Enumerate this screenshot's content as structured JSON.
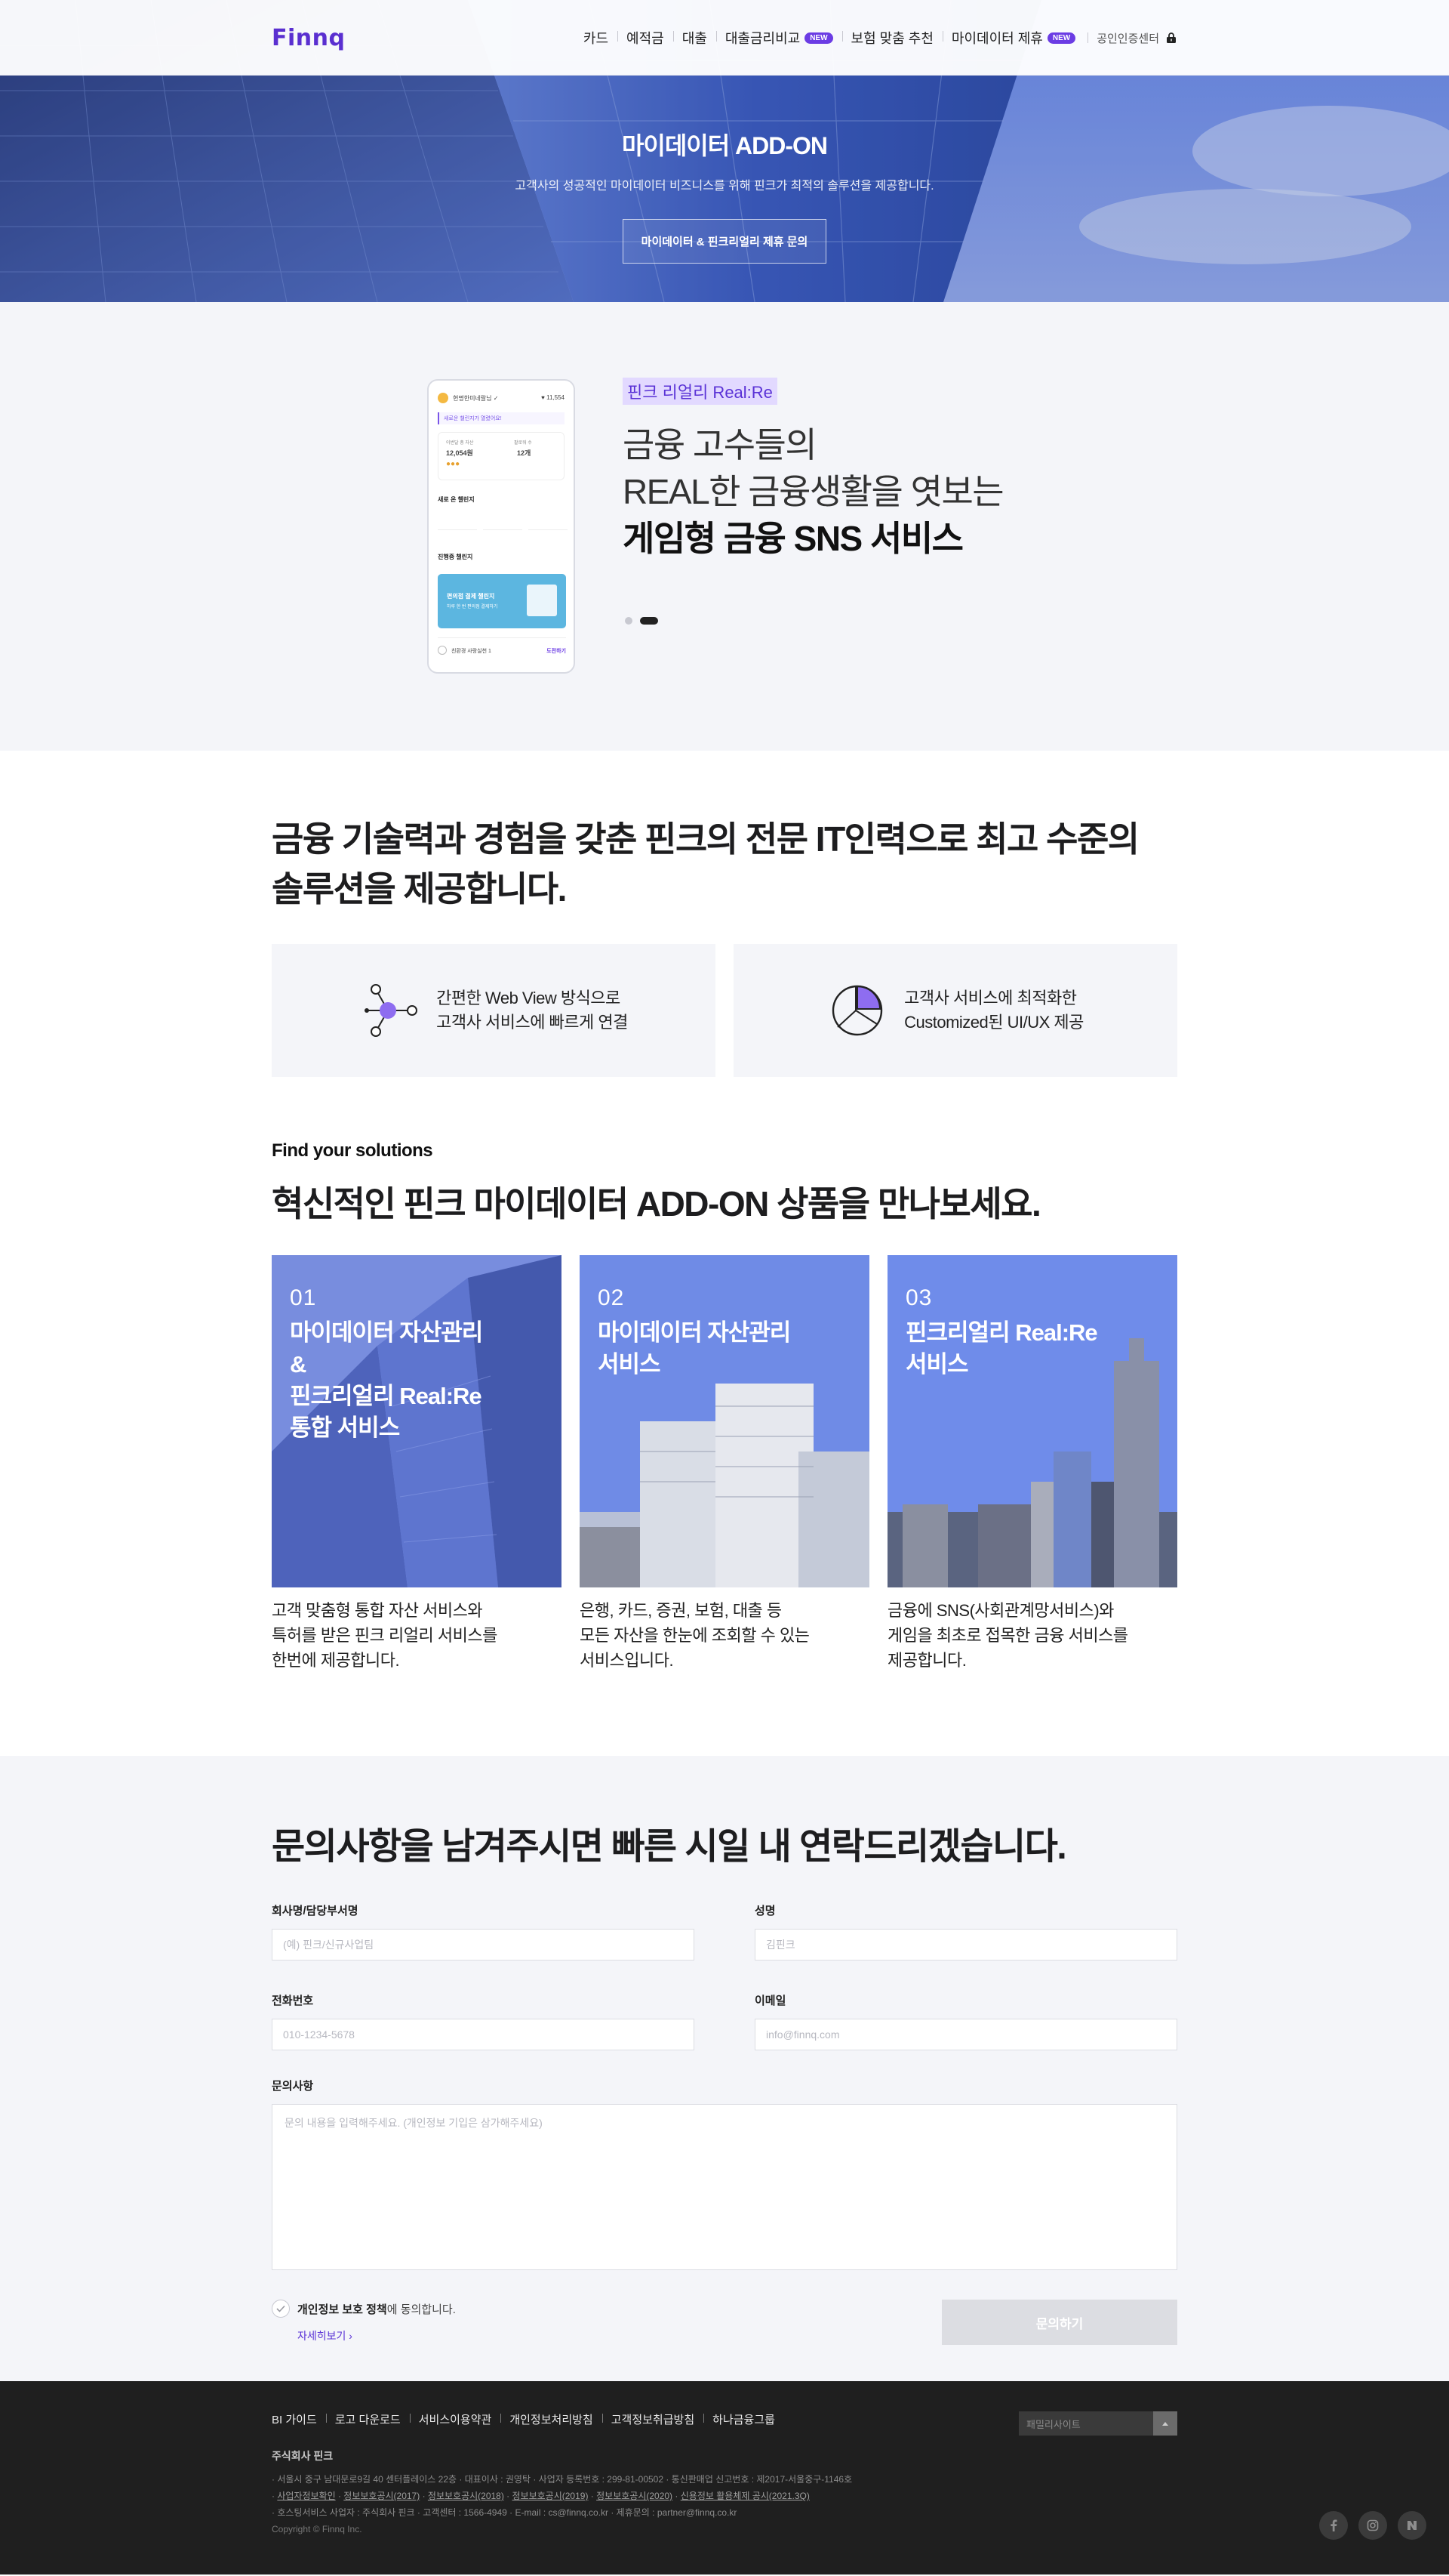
{
  "header": {
    "logo": "Finnq",
    "nav": [
      {
        "label": "카드",
        "new": false
      },
      {
        "label": "예적금",
        "new": false
      },
      {
        "label": "대출",
        "new": false
      },
      {
        "label": "대출금리비교",
        "new": true
      },
      {
        "label": "보험 맞춤 추천",
        "new": false
      },
      {
        "label": "마이데이터 제휴",
        "new": true
      }
    ],
    "new_badge": "NEW",
    "cert_label": "공인인증센터"
  },
  "hero": {
    "title": "마이데이터 ADD-ON",
    "subtitle": "고객사의 성공적인 마이데이터 비즈니스를 위해 핀크가 최적의 솔루션을 제공합니다.",
    "button": "마이데이터 & 핀크리얼리 제휴 문의"
  },
  "realre": {
    "tag": "핀크 리얼리 Real:Re",
    "line1": "금융 고수들의",
    "line2": "REAL한 금융생활을 엿보는",
    "line3": "게임형 금융 SNS 서비스",
    "phone": {
      "user": "현명한미네랄님 ✓",
      "points": "11,554",
      "banner": "새로운 챌린지가 열렸어요!",
      "stat1_label": "이번달 총 자산",
      "stat1_value": "12,054원",
      "stat2_label": "팔로워 수",
      "stat2_value": "12개",
      "section1": "새로 온 챌린지",
      "section2": "진행중 챌린지",
      "card_title": "편의점 결제 챌린지",
      "card_sub": "하루 한 번 편의점 결제하기",
      "bottom": "친환경 사랑실천 1",
      "bottom_btn": "도전하기"
    }
  },
  "solution": {
    "heading": "금융 기술력과 경험을 갖춘 핀크의 전문 IT인력으로 최고 수준의 솔루션을 제공합니다.",
    "features": [
      {
        "line1": "간편한 Web View 방식으로",
        "line2": "고객사 서비스에 빠르게 연결"
      },
      {
        "line1": "고객사 서비스에 최적화한",
        "line2": "Customized된 UI/UX 제공"
      }
    ],
    "find_small": "Find your solutions",
    "find_heading": "혁신적인 핀크 마이데이터 ADD-ON 상품을 만나보세요.",
    "products": [
      {
        "num": "01",
        "title": "마이데이터 자산관리\n&\n핀크리얼리 Real:Re\n통합 서비스",
        "desc": "고객 맞춤형 통합 자산 서비스와\n특허를 받은 핀크 리얼리 서비스를\n한번에 제공합니다."
      },
      {
        "num": "02",
        "title": "마이데이터 자산관리\n서비스",
        "desc": "은행, 카드, 증권, 보험, 대출 등\n모든 자산을 한눈에 조회할 수 있는\n서비스입니다."
      },
      {
        "num": "03",
        "title": "핀크리얼리 Real:Re\n서비스",
        "desc": "금융에 SNS(사회관계망서비스)와\n게임을 최초로 접목한 금융 서비스를\n제공합니다."
      }
    ]
  },
  "contact": {
    "heading": "문의사항을 남겨주시면 빠른 시일 내 연락드리겠습니다.",
    "fields": {
      "company": {
        "label": "회사명/담당부서명",
        "placeholder": "(예) 핀크/신규사업팀"
      },
      "name": {
        "label": "성명",
        "placeholder": "김핀크"
      },
      "phone": {
        "label": "전화번호",
        "placeholder": "010-1234-5678"
      },
      "email": {
        "label": "이메일",
        "placeholder": "info@finnq.com"
      },
      "message": {
        "label": "문의사항",
        "placeholder": "문의 내용을 입력해주세요. (개인정보 기입은 삼가해주세요)"
      }
    },
    "agree_bold": "개인정보 보호 정책",
    "agree_rest": "에 동의합니다.",
    "more": "자세히보기",
    "submit": "문의하기"
  },
  "footer": {
    "links": [
      "BI 가이드",
      "로고 다운로드",
      "서비스이용약관",
      "개인정보처리방침",
      "고객정보취급방침",
      "하나금융그룹"
    ],
    "family_site": "패밀리사이트",
    "company": "주식회사 핀크",
    "info1": "서울시 중구 남대문로9길 40 센터플레이스 22층 · 대표이사 : 권영탁 · 사업자 등록번호 : 299-81-00502 · 통신판매업 신고번호 : 제2017-서울중구-1146호",
    "info2_links": [
      "사업자정보확인",
      "정보보호공시(2017)",
      "정보보호공시(2018)",
      "정보보호공시(2019)",
      "정보보호공시(2020)",
      "신용정보 활용체제 공시(2021.3Q)"
    ],
    "info3": "· 호스팅서비스 사업자 : 주식회사 핀크 · 고객센터 : 1566-4949 · E-mail : cs@finnq.co.kr · 제휴문의 : partner@finnq.co.kr",
    "copyright": "Copyright © Finnq Inc.",
    "social": [
      "facebook-icon",
      "instagram-icon",
      "naver-blog-icon"
    ]
  }
}
